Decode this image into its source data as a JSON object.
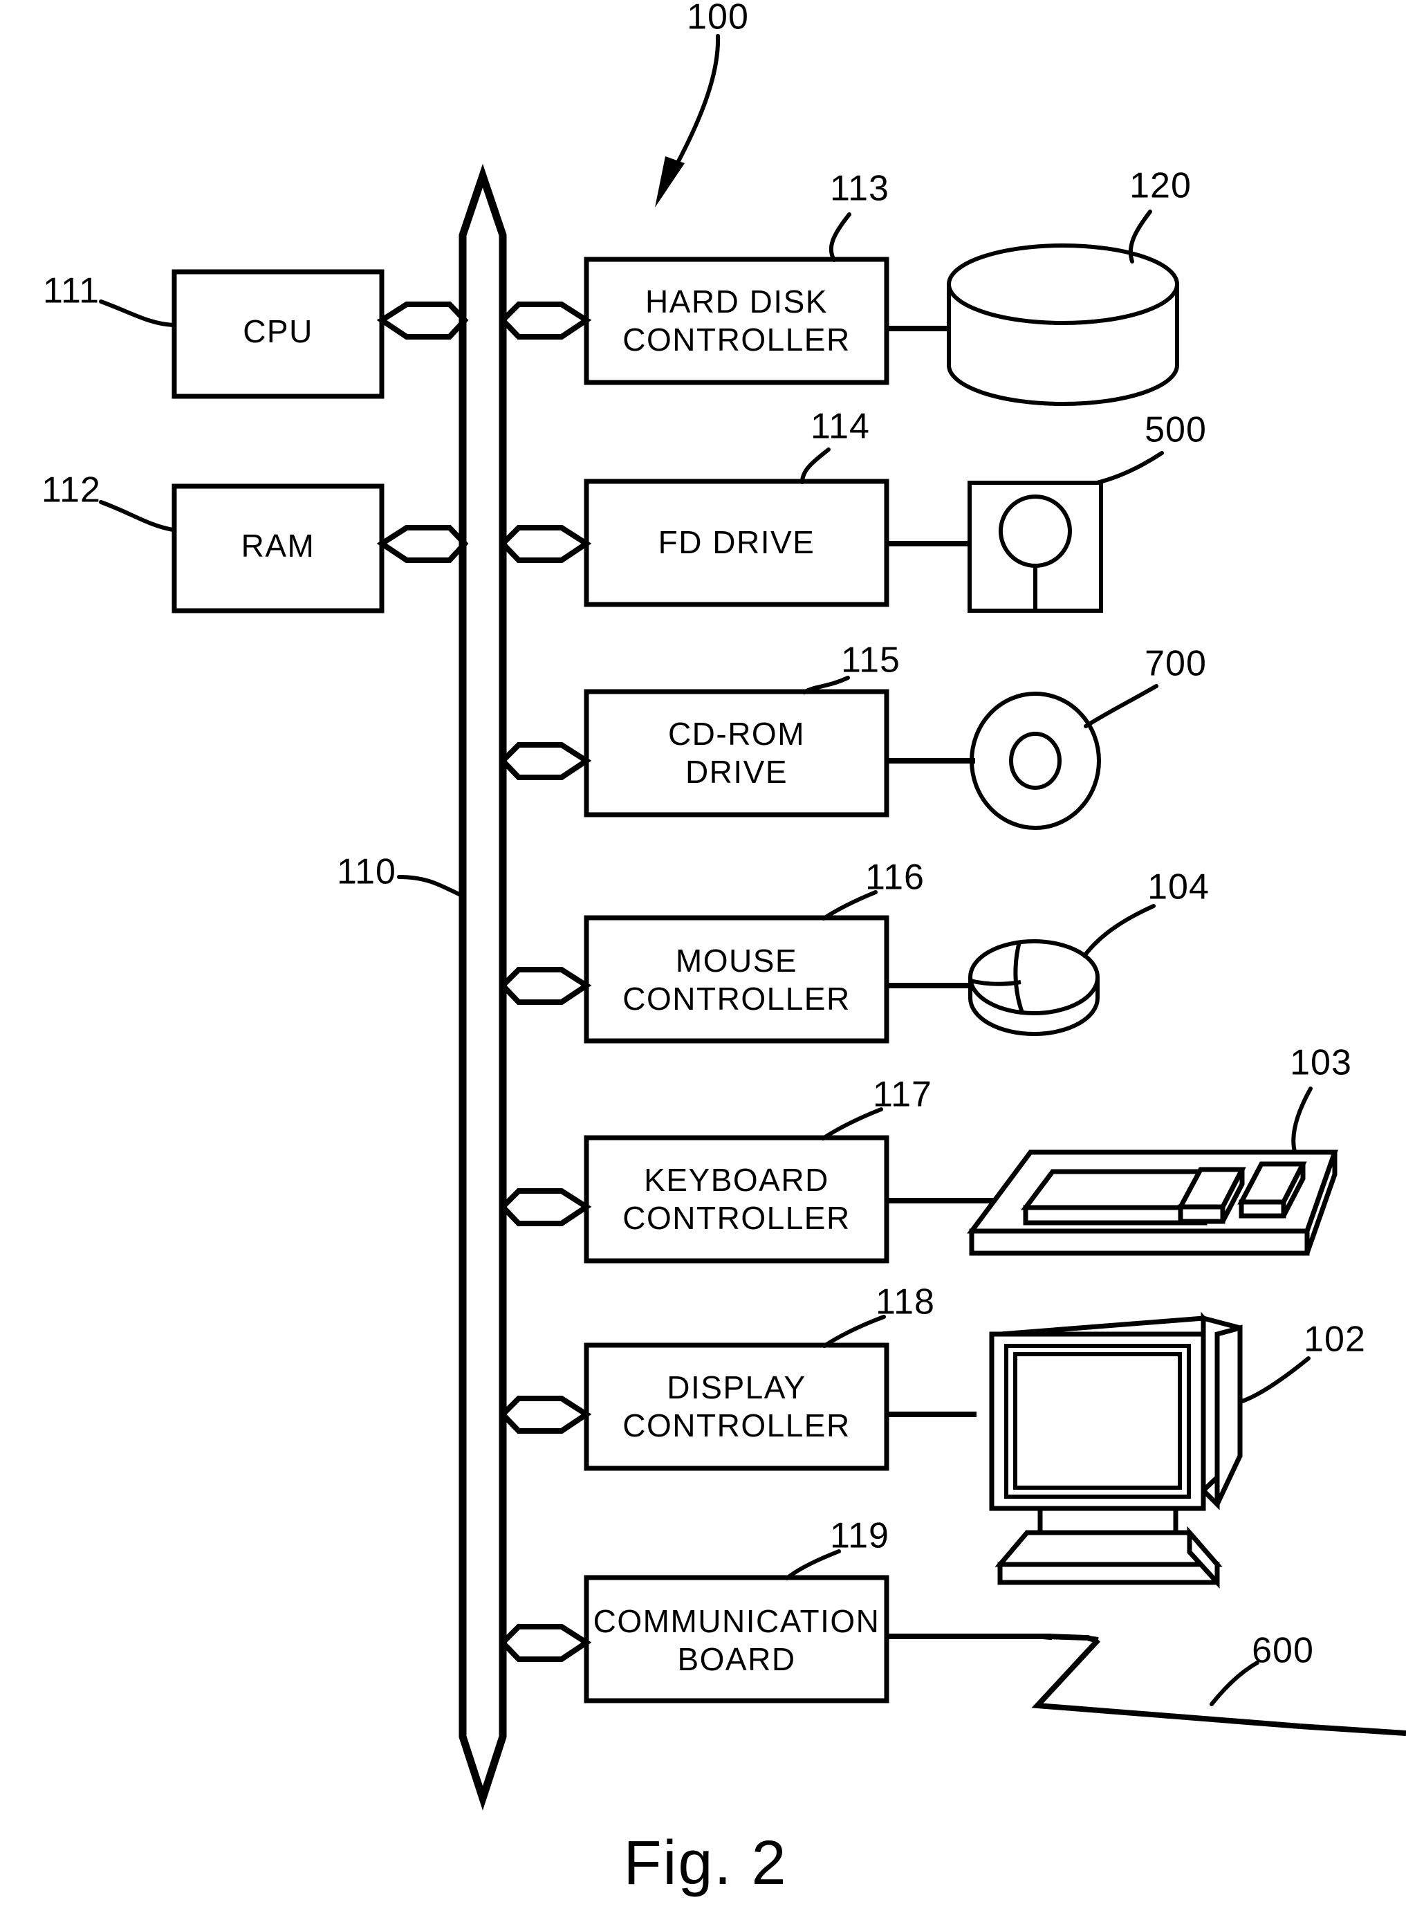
{
  "figure": {
    "caption": "Fig. 2",
    "system_ref": "100",
    "bus_ref": "110"
  },
  "blocks": [
    {
      "id": "cpu",
      "label_line1": "CPU",
      "label_line2": "",
      "ref": "111"
    },
    {
      "id": "ram",
      "label_line1": "RAM",
      "label_line2": "",
      "ref": "112"
    },
    {
      "id": "hard-disk-controller",
      "label_line1": "HARD DISK",
      "label_line2": "CONTROLLER",
      "ref": "113"
    },
    {
      "id": "fd-drive",
      "label_line1": "FD DRIVE",
      "label_line2": "",
      "ref": "114"
    },
    {
      "id": "cd-rom-drive",
      "label_line1": "CD-ROM",
      "label_line2": "DRIVE",
      "ref": "115"
    },
    {
      "id": "mouse-controller",
      "label_line1": "MOUSE",
      "label_line2": "CONTROLLER",
      "ref": "116"
    },
    {
      "id": "keyboard-controller",
      "label_line1": "KEYBOARD",
      "label_line2": "CONTROLLER",
      "ref": "117"
    },
    {
      "id": "display-controller",
      "label_line1": "DISPLAY",
      "label_line2": "CONTROLLER",
      "ref": "118"
    },
    {
      "id": "communication-board",
      "label_line1": "COMMUNICATION",
      "label_line2": "BOARD",
      "ref": "119"
    }
  ],
  "peripherals": [
    {
      "id": "hard-disk",
      "name": "hard-disk-cylinder",
      "ref": "120"
    },
    {
      "id": "floppy-disk",
      "name": "floppy-disk",
      "ref": "500"
    },
    {
      "id": "cd-rom-disc",
      "name": "cd-rom-disc",
      "ref": "700"
    },
    {
      "id": "mouse",
      "name": "mouse-device",
      "ref": "104"
    },
    {
      "id": "keyboard",
      "name": "keyboard-device",
      "ref": "103"
    },
    {
      "id": "display",
      "name": "crt-display",
      "ref": "102"
    },
    {
      "id": "network",
      "name": "network-line",
      "ref": "600"
    }
  ],
  "colors": {
    "ink": "#000000",
    "paper": "#ffffff"
  }
}
